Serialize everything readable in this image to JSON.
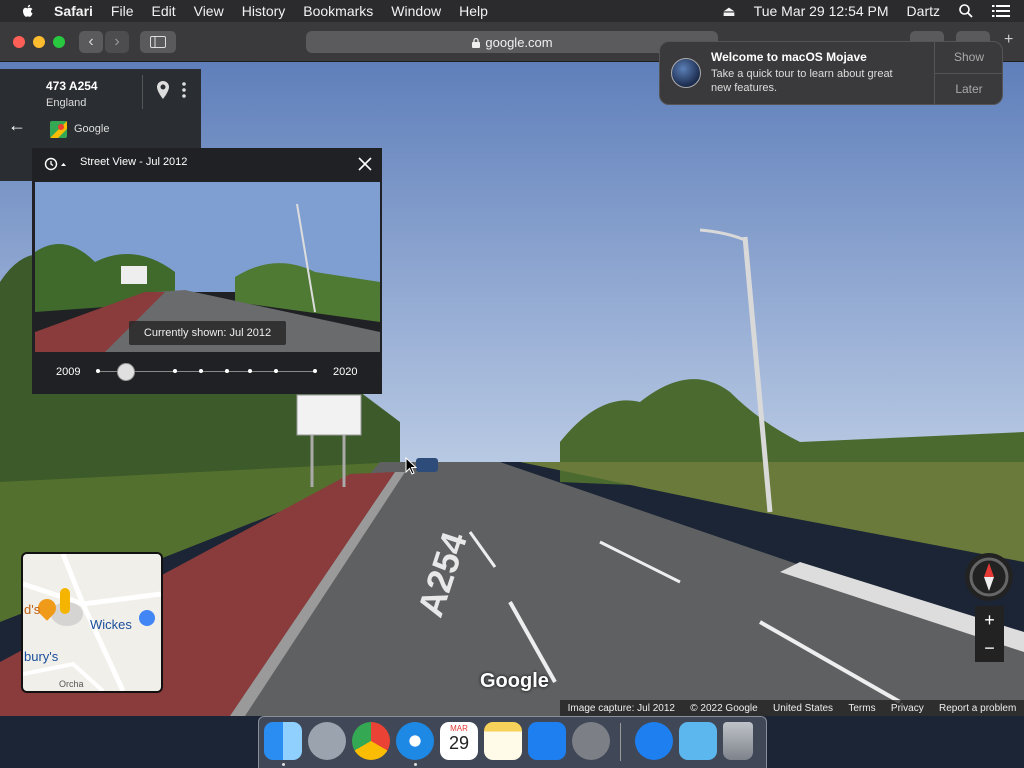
{
  "menubar": {
    "app_name": "Safari",
    "items": [
      "File",
      "Edit",
      "View",
      "History",
      "Bookmarks",
      "Window",
      "Help"
    ],
    "datetime": "Tue Mar 29  12:54 PM",
    "user": "Dartz"
  },
  "browser": {
    "url": "google.com"
  },
  "place": {
    "title": "473 A254",
    "subtitle": "England",
    "source": "Google"
  },
  "streetview": {
    "header": "Street View - Jul 2012",
    "tooltip": "Currently shown: Jul 2012",
    "year_start": "2009",
    "year_end": "2020",
    "slider_position": 0.13
  },
  "notification": {
    "title": "Welcome to macOS Mojave",
    "body_line1": "Take a quick tour to learn about great",
    "body_line2": "new features.",
    "show_label": "Show",
    "later_label": "Later"
  },
  "minimap": {
    "label_wickes": "Wickes",
    "label_sainsburys": "bury's",
    "label_partial": "d's",
    "label_road": "Orcha"
  },
  "map": {
    "road_marking": "A254",
    "watermark": "Google"
  },
  "footer": {
    "capture": "Image capture: Jul 2012",
    "copyright": "© 2022 Google",
    "region": "United States",
    "terms": "Terms",
    "privacy": "Privacy",
    "report": "Report a problem"
  },
  "dock": {
    "calendar_month": "MAR",
    "calendar_day": "29"
  },
  "colors": {
    "accent_blue": "#1a73e8",
    "bike_lane": "#8a3b3b",
    "sky": "#6f8fc4"
  }
}
